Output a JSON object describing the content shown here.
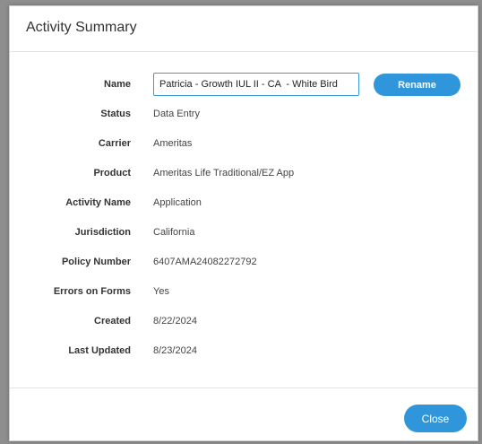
{
  "modal": {
    "title": "Activity Summary",
    "rename_label": "Rename",
    "close_label": "Close"
  },
  "fields": [
    {
      "label": "Name",
      "value": "Patricia - Growth IUL II - CA  - White Bird"
    },
    {
      "label": "Status",
      "value": "Data Entry"
    },
    {
      "label": "Carrier",
      "value": "Ameritas"
    },
    {
      "label": "Product",
      "value": "Ameritas Life Traditional/EZ App"
    },
    {
      "label": "Activity Name",
      "value": "Application"
    },
    {
      "label": "Jurisdiction",
      "value": "California"
    },
    {
      "label": "Policy Number",
      "value": "6407AMA24082272792"
    },
    {
      "label": "Errors on Forms",
      "value": "Yes"
    },
    {
      "label": "Created",
      "value": "8/22/2024"
    },
    {
      "label": "Last Updated",
      "value": "8/23/2024"
    }
  ],
  "colors": {
    "accent": "#2f96dc",
    "input_border": "#3b9bd8"
  }
}
